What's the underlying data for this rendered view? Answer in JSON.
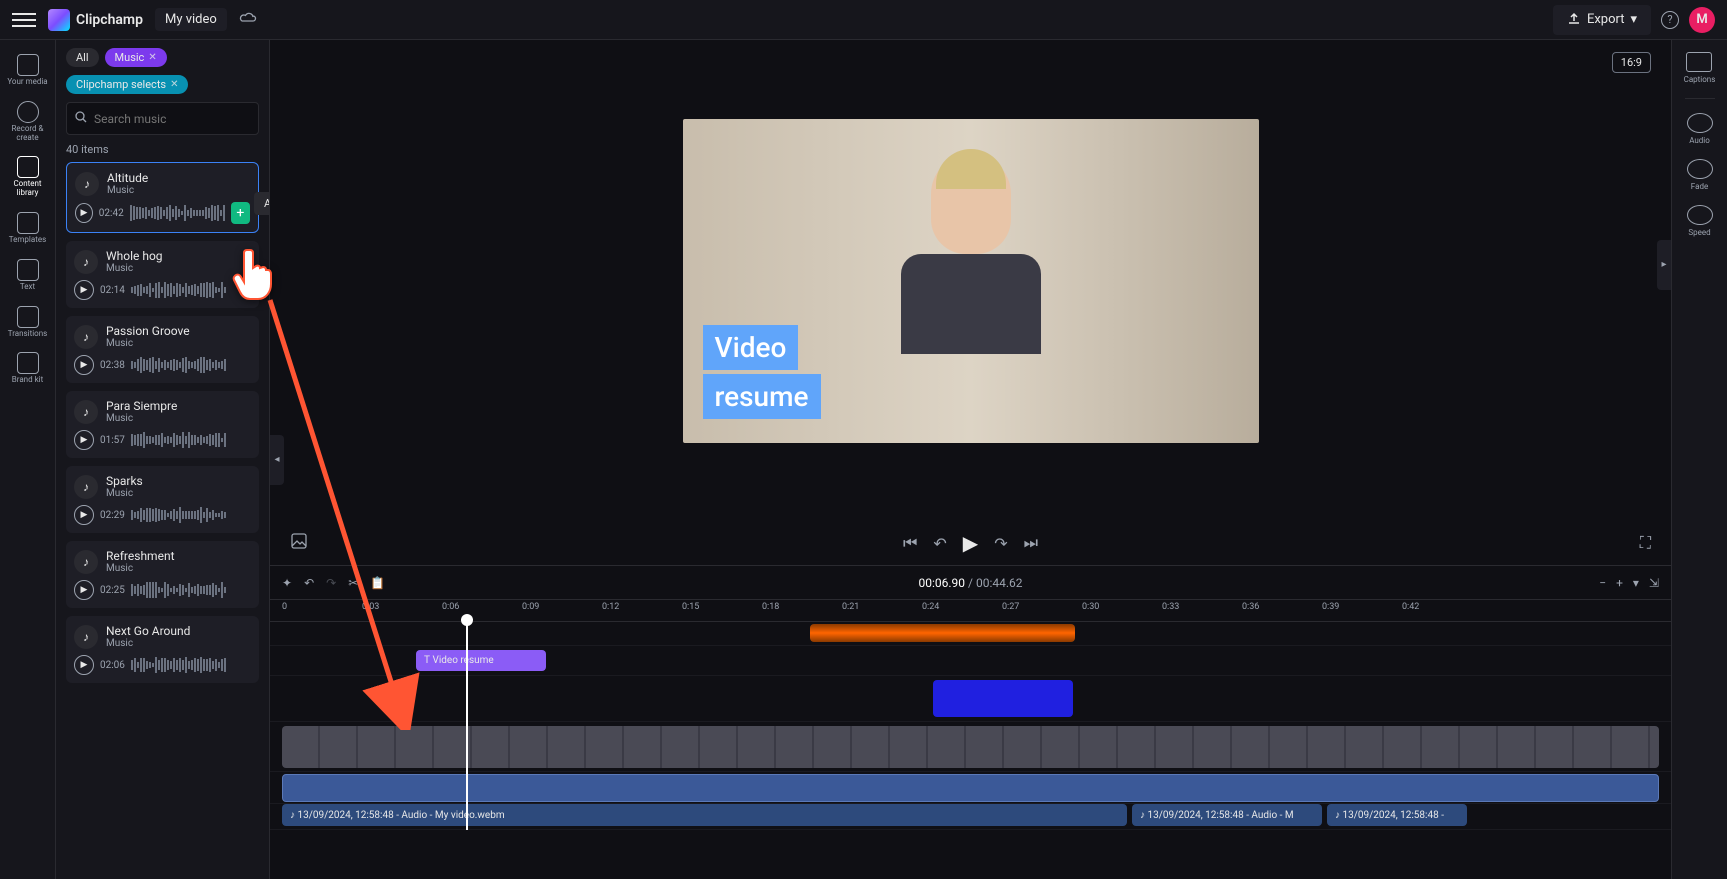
{
  "app": {
    "name": "Clipchamp",
    "project": "My video"
  },
  "topbar": {
    "export": "Export",
    "avatar_initial": "M"
  },
  "aspect": "16:9",
  "rail": [
    {
      "label": "Your media"
    },
    {
      "label": "Record & create"
    },
    {
      "label": "Content library"
    },
    {
      "label": "Templates"
    },
    {
      "label": "Text"
    },
    {
      "label": "Transitions"
    },
    {
      "label": "Brand kit"
    }
  ],
  "filters": {
    "all": "All",
    "music": "Music",
    "selects": "Clipchamp selects"
  },
  "search": {
    "placeholder": "Search music"
  },
  "item_count": "40 items",
  "tooltip": "Add to timeline",
  "tracks": [
    {
      "title": "Altitude",
      "sub": "Music",
      "dur": "02:42",
      "active": true
    },
    {
      "title": "Whole hog",
      "sub": "Music",
      "dur": "02:14"
    },
    {
      "title": "Passion Groove",
      "sub": "Music",
      "dur": "02:38"
    },
    {
      "title": "Para Siempre",
      "sub": "Music",
      "dur": "01:57"
    },
    {
      "title": "Sparks",
      "sub": "Music",
      "dur": "02:29"
    },
    {
      "title": "Refreshment",
      "sub": "Music",
      "dur": "02:25"
    },
    {
      "title": "Next Go Around",
      "sub": "Music",
      "dur": "02:06"
    }
  ],
  "overlay": {
    "line1": "Video",
    "line2": "resume"
  },
  "time": {
    "current": "00:06.90",
    "sep": " / ",
    "total": "00:44.62"
  },
  "ruler": [
    "0",
    "0:03",
    "0:06",
    "0:09",
    "0:12",
    "0:15",
    "0:18",
    "0:21",
    "0:24",
    "0:27",
    "0:30",
    "0:33",
    "0:36",
    "0:39",
    "0:42"
  ],
  "clips": {
    "text_label": "Video resume",
    "audio1": "13/09/2024, 12:58:48 - Audio - My video.webm",
    "audio2": "13/09/2024, 12:58:48 - Audio - M",
    "audio3": "13/09/2024, 12:58:48 -"
  },
  "right_rail": [
    {
      "label": "Captions"
    },
    {
      "label": "Audio"
    },
    {
      "label": "Fade"
    },
    {
      "label": "Speed"
    }
  ]
}
